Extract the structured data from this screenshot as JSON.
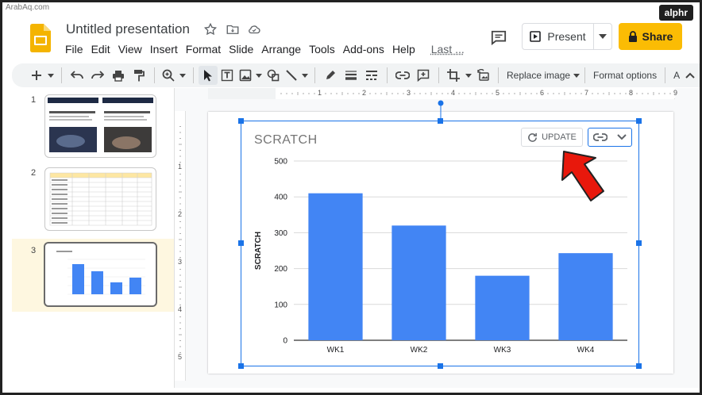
{
  "watermark": "ArabAq.com",
  "brand": "alphr",
  "header": {
    "title": "Untitled presentation",
    "present_label": "Present",
    "share_label": "Share",
    "menu": [
      "File",
      "Edit",
      "View",
      "Insert",
      "Format",
      "Slide",
      "Arrange",
      "Tools",
      "Add-ons",
      "Help",
      "Last ..."
    ]
  },
  "toolbar": {
    "replace_image_label": "Replace image",
    "format_options_label": "Format options",
    "trailing_label": "A"
  },
  "ruler": {
    "top_labels": [
      "1",
      "2",
      "3",
      "4",
      "5",
      "6",
      "7",
      "8",
      "9"
    ],
    "left_labels": [
      "1",
      "2",
      "3",
      "4",
      "5"
    ]
  },
  "filmstrip": {
    "slides": [
      {
        "number": "1",
        "selected": false
      },
      {
        "number": "2",
        "selected": false
      },
      {
        "number": "3",
        "selected": true
      }
    ]
  },
  "chart_actions": {
    "update_label": "UPDATE"
  },
  "colors": {
    "bar": "#4285f4",
    "share": "#fbbc04",
    "selection": "#1a73e8",
    "arrow": "#e8180c"
  },
  "chart_data": {
    "type": "bar",
    "title": "SCRATCH",
    "xlabel": "",
    "ylabel": "SCRATCH",
    "categories": [
      "WK1",
      "WK2",
      "WK3",
      "WK4"
    ],
    "values": [
      410,
      320,
      180,
      243
    ],
    "ylim": [
      0,
      500
    ],
    "yticks": [
      0,
      100,
      200,
      300,
      400,
      500
    ],
    "grid": true,
    "legend": "none"
  }
}
